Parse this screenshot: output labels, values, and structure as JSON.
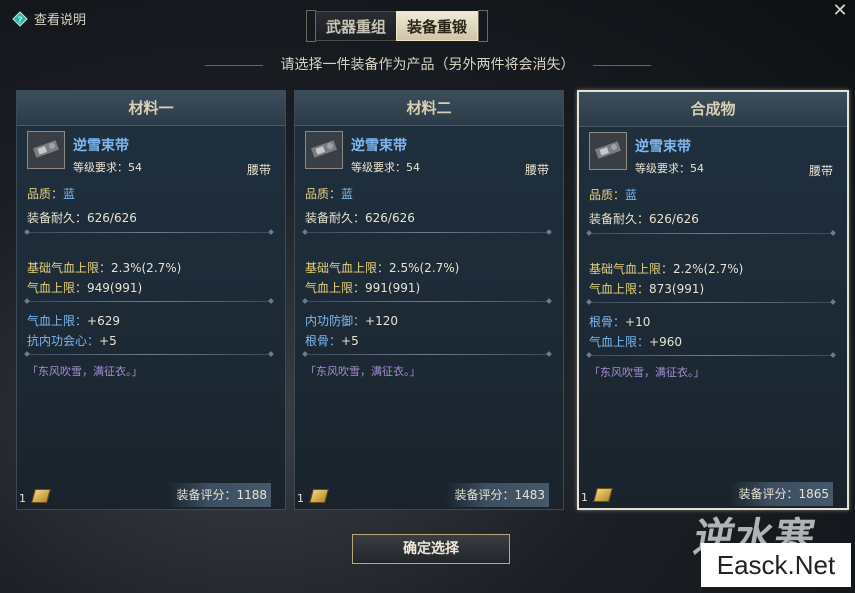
{
  "header": {
    "help_label": "查看说明",
    "close": "✕",
    "tabs": [
      {
        "label": "武器重组",
        "active": false
      },
      {
        "label": "装备重锻",
        "active": true
      }
    ]
  },
  "subtitle": "请选择一件装备作为产品（另外两件将会消失）",
  "cards": [
    {
      "title": "材料一",
      "item_name": "逆雪束带",
      "level_label": "等级要求：",
      "level_value": "54",
      "slot": "腰带",
      "quality_label": "品质：",
      "quality_value": "蓝",
      "durability_label": "装备耐久：",
      "durability_value": "626/626",
      "base_stats": [
        {
          "label": "基础气血上限：",
          "value": "2.3%(2.7%)"
        },
        {
          "label": "气血上限：",
          "value": "949(991)"
        }
      ],
      "extra_stats": [
        {
          "label": "气血上限：",
          "value": "+629"
        },
        {
          "label": "抗内功会心：",
          "value": "+5"
        }
      ],
      "flavor": "「东风吹雪，满征衣。」",
      "count": "1",
      "score_label": "装备评分：",
      "score_value": "1188",
      "selected": false
    },
    {
      "title": "材料二",
      "item_name": "逆雪束带",
      "level_label": "等级要求：",
      "level_value": "54",
      "slot": "腰带",
      "quality_label": "品质：",
      "quality_value": "蓝",
      "durability_label": "装备耐久：",
      "durability_value": "626/626",
      "base_stats": [
        {
          "label": "基础气血上限：",
          "value": "2.5%(2.7%)"
        },
        {
          "label": "气血上限：",
          "value": "991(991)"
        }
      ],
      "extra_stats": [
        {
          "label": "内功防御：",
          "value": "+120"
        },
        {
          "label": "根骨：",
          "value": "+5"
        }
      ],
      "flavor": "「东风吹雪，满征衣。」",
      "count": "1",
      "score_label": "装备评分：",
      "score_value": "1483",
      "selected": false
    },
    {
      "title": "合成物",
      "item_name": "逆雪束带",
      "level_label": "等级要求：",
      "level_value": "54",
      "slot": "腰带",
      "quality_label": "品质：",
      "quality_value": "蓝",
      "durability_label": "装备耐久：",
      "durability_value": "626/626",
      "base_stats": [
        {
          "label": "基础气血上限：",
          "value": "2.2%(2.7%)"
        },
        {
          "label": "气血上限：",
          "value": "873(991)"
        }
      ],
      "extra_stats": [
        {
          "label": "根骨：",
          "value": "+10"
        },
        {
          "label": "气血上限：",
          "value": "+960"
        }
      ],
      "flavor": "「东风吹雪，满征衣。」",
      "count": "1",
      "score_label": "装备评分：",
      "score_value": "1865",
      "selected": true
    }
  ],
  "confirm_label": "确定选择",
  "watermark": "Easck.Net",
  "watermark_brush": "逆水寒",
  "colors": {
    "item_name": "#7fb8f0",
    "quality": "#e6d27a",
    "flavor": "#a58fd0",
    "selected_border": "#e6e1d2"
  }
}
